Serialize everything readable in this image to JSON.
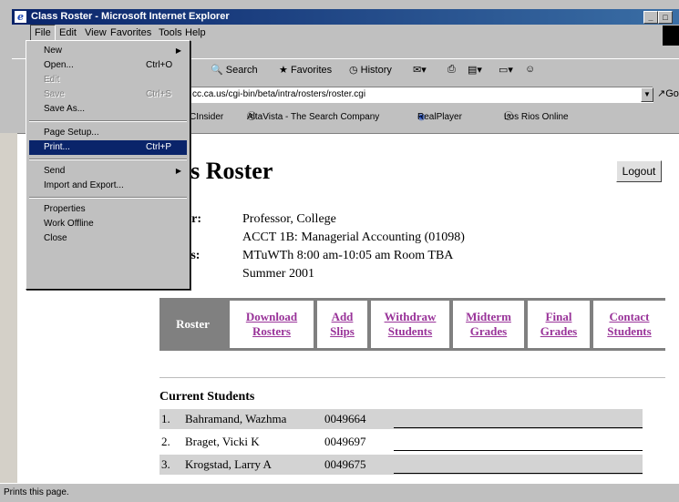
{
  "window": {
    "title": "Class Roster - Microsoft Internet Explorer"
  },
  "menubar": [
    "File",
    "Edit",
    "View",
    "Favorites",
    "Tools",
    "Help"
  ],
  "toolbar": {
    "search": "Search",
    "favorites": "Favorites",
    "history": "History"
  },
  "address": {
    "url": "cc.ca.us/cgi-bin/beta/intra/rosters/roster.cgi",
    "go": "Go"
  },
  "links": [
    "CInsider",
    "AltaVista - The Search Company",
    "RealPlayer",
    "Los Rios Online"
  ],
  "file_menu": {
    "new": "New",
    "open": "Open...",
    "open_sc": "Ctrl+O",
    "edit": "Edit",
    "save": "Save",
    "save_sc": "Ctrl+S",
    "save_as": "Save As...",
    "page_setup": "Page Setup...",
    "print": "Print...",
    "print_sc": "Ctrl+P",
    "send": "Send",
    "import_export": "Import and Export...",
    "properties": "Properties",
    "work_offline": "Work Offline",
    "close": "Close"
  },
  "page": {
    "title": "ass Roster",
    "logout": "Logout",
    "professor_label": "essor:",
    "professor": "Professor, College",
    "course_label": "rse:",
    "course": "ACCT 1B: Managerial Accounting (01098)",
    "meetings_label": "tings:",
    "meetings": "MTuWTh 8:00 am-10:05 am Room TBA",
    "term_label": "n:",
    "term": "Summer 2001"
  },
  "tabs": {
    "roster": "Roster",
    "download_1": "Download",
    "download_2": "Rosters",
    "add_1": "Add",
    "add_2": "Slips",
    "withdraw_1": "Withdraw",
    "withdraw_2": "Students",
    "midterm_1": "Midterm",
    "midterm_2": "Grades",
    "final_1": "Final",
    "final_2": "Grades",
    "contact_1": "Contact",
    "contact_2": "Students"
  },
  "students_heading": "Current Students",
  "students": [
    {
      "num": "1.",
      "name": "Bahramand, Wazhma",
      "id": "0049664"
    },
    {
      "num": "2.",
      "name": "Braget, Vicki K",
      "id": "0049697"
    },
    {
      "num": "3.",
      "name": "Krogstad, Larry A",
      "id": "0049675"
    }
  ],
  "status": "Prints this page."
}
